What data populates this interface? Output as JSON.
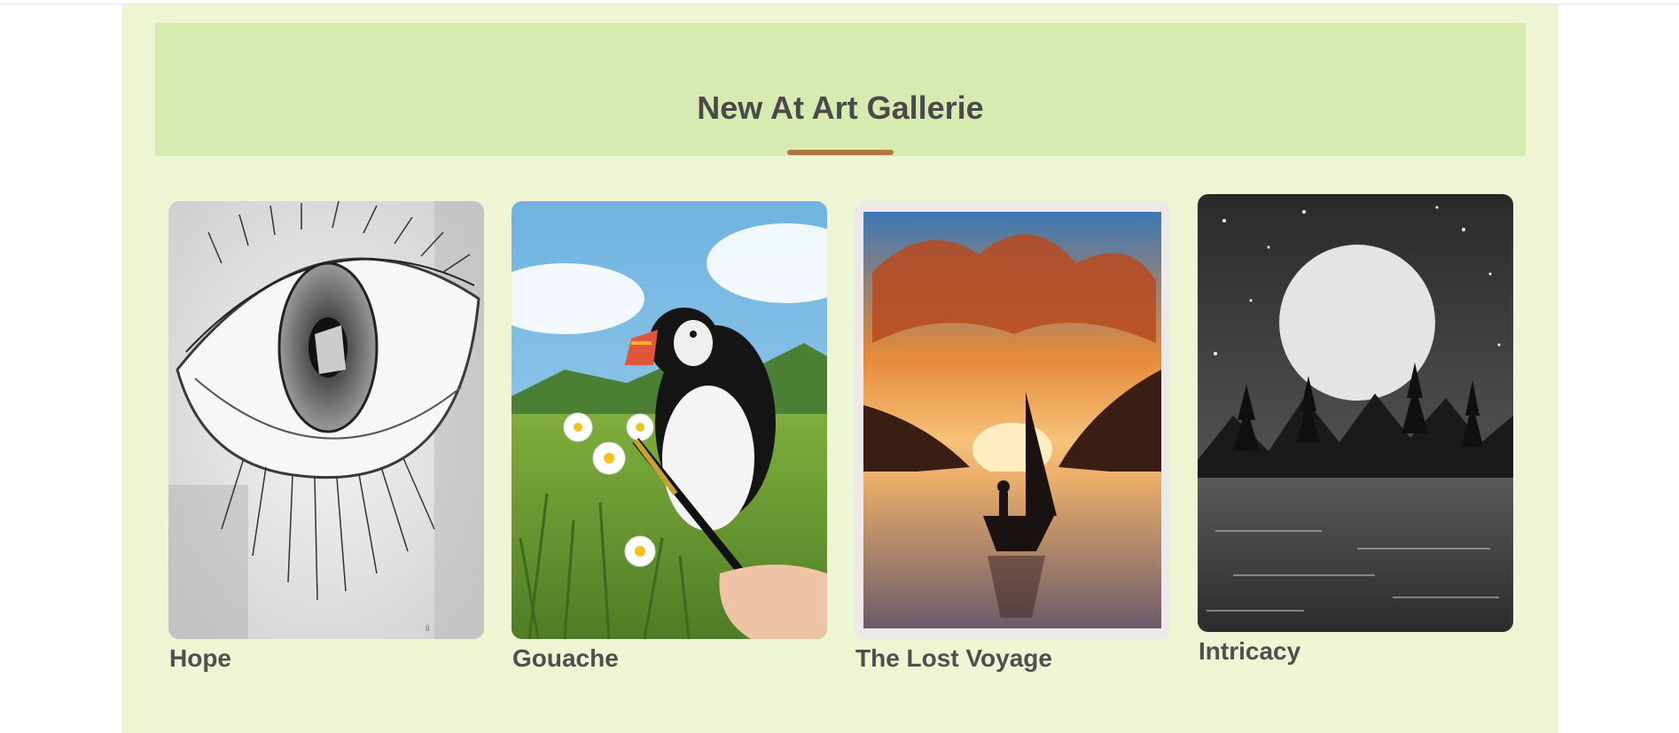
{
  "gallery": {
    "heading": "New At Art Gallerie",
    "items": [
      {
        "title": "Hope",
        "image": "eye-pencil-sketch"
      },
      {
        "title": "Gouache",
        "image": "puffin-gouache-painting"
      },
      {
        "title": "The Lost Voyage",
        "image": "boat-sunset-watercolor"
      },
      {
        "title": "Intricacy",
        "image": "moonlit-mountains-painting"
      }
    ]
  },
  "colors": {
    "section_bg": "#eef5d3",
    "banner_bg": "#d7eab0",
    "accent_underline": "#b07840",
    "text": "#4a4a4a"
  }
}
